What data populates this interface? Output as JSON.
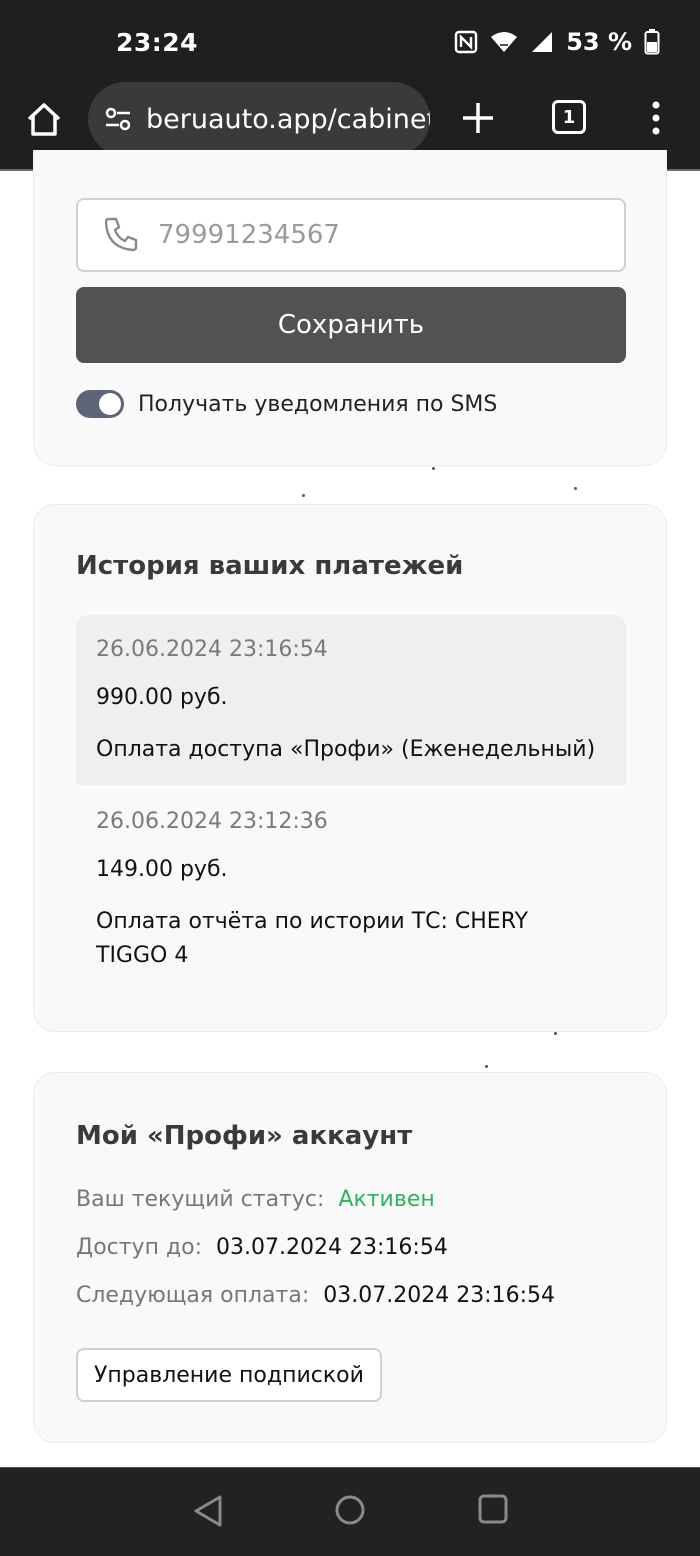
{
  "status_bar": {
    "time": "23:24",
    "battery": "53 %",
    "icons": [
      "nfc-icon",
      "wifi-icon",
      "signal-icon",
      "battery-icon"
    ]
  },
  "browser": {
    "url": "beruauto.app/cabinet",
    "tab_count": "1",
    "icons": [
      "home-icon",
      "site-settings-icon",
      "new-tab-icon",
      "tabs-icon",
      "menu-icon"
    ]
  },
  "settings": {
    "phone_placeholder": "79991234567",
    "save_label": "Сохранить",
    "sms_toggle_label": "Получать уведомления по SMS",
    "sms_toggle_on": true
  },
  "payments": {
    "title": "История ваших платежей",
    "items": [
      {
        "date": "26.06.2024 23:16:54",
        "amount": "990.00 руб.",
        "description": "Оплата доступа «Профи» (Еженедельный)"
      },
      {
        "date": "26.06.2024 23:12:36",
        "amount": "149.00 руб.",
        "description": "Оплата отчёта по истории ТС: CHERY TIGGO 4"
      }
    ]
  },
  "account": {
    "title": "Мой «Профи» аккаунт",
    "status_label": "Ваш текущий статус:",
    "status_value": "Активен",
    "access_label": "Доступ до:",
    "access_value": "03.07.2024 23:16:54",
    "next_payment_label": "Следующая оплата:",
    "next_payment_value": "03.07.2024 23:16:54",
    "manage_label": "Управление подпиской"
  },
  "colors": {
    "active_status": "#2eb45a",
    "primary_button": "#525254",
    "toggle_on": "#5d6478"
  },
  "nav_bar": {
    "icons": [
      "back-icon",
      "home-nav-icon",
      "recents-icon"
    ]
  }
}
